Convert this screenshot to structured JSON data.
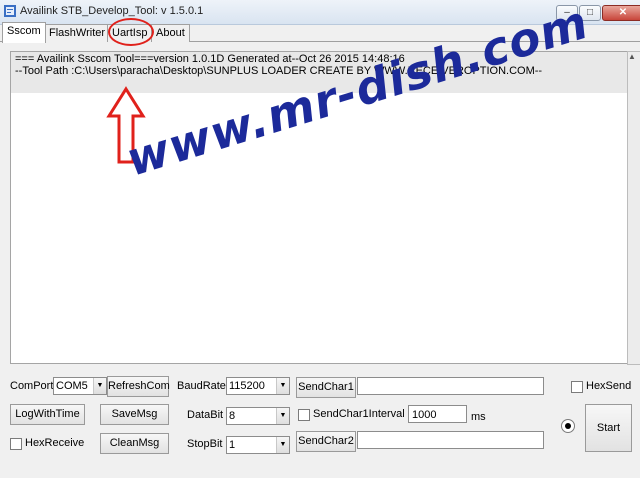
{
  "window": {
    "title": "Availink STB_Develop_Tool: v 1.5.0.1",
    "min_symbol": "–",
    "max_symbol": "□",
    "close_symbol": "✕"
  },
  "tabs": [
    {
      "label": "Sscom"
    },
    {
      "label": "FlashWriter"
    },
    {
      "label": "UartIsp"
    },
    {
      "label": "About"
    }
  ],
  "log": {
    "line1": "=== Availink Sscom Tool===version 1.0.1D Generated at--Oct 26 2015 14:48:16",
    "line2": "--Tool Path :C:\\Users\\paracha\\Desktop\\SUNPLUS LOADER CREATE BY WWW.RECEIVEROPTION.COM--"
  },
  "watermark": "www.mr-dish.com",
  "controls": {
    "comport_label": "ComPort",
    "comport_value": "COM5",
    "refresh_button": "RefreshCom",
    "log_with_time_button": "LogWithTime",
    "save_msg_button": "SaveMsg",
    "hex_receive_label": "HexReceive",
    "clean_msg_button": "CleanMsg",
    "baudrate_label": "BaudRate",
    "baudrate_value": "115200",
    "databit_label": "DataBit",
    "databit_value": "8",
    "stopbit_label": "StopBit",
    "stopbit_value": "1",
    "send_char1_button": "SendChar1",
    "send_char1_value": "",
    "send_char1_interval_label": "SendChar1Interval",
    "interval_value": "1000",
    "interval_unit": "ms",
    "send_char2_button": "SendChar2",
    "send_char2_value": "",
    "hex_send_label": "HexSend",
    "start_button": "Start"
  },
  "colors": {
    "watermark": "#1c2a9a",
    "highlight": "#e0211b"
  }
}
